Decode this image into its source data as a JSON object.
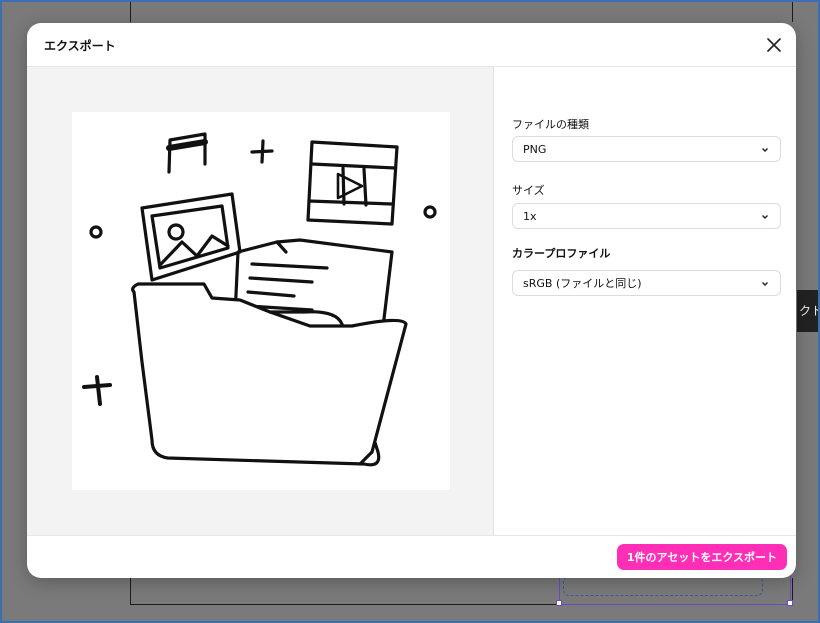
{
  "background": {
    "tooltip_text": "クト"
  },
  "dialog": {
    "title": "エクスポート",
    "close_icon": "close-icon",
    "fields": {
      "file_type": {
        "label": "ファイルの種類",
        "value": "PNG"
      },
      "size": {
        "label": "サイズ",
        "value": "1x"
      },
      "color_profile": {
        "label": "カラープロファイル",
        "value": "sRGB (ファイルと同じ)"
      }
    },
    "export_button_label": "1件のアセットをエクスポート"
  },
  "colors": {
    "accent": "#ff2eb6",
    "selection": "#6b4bc0"
  }
}
